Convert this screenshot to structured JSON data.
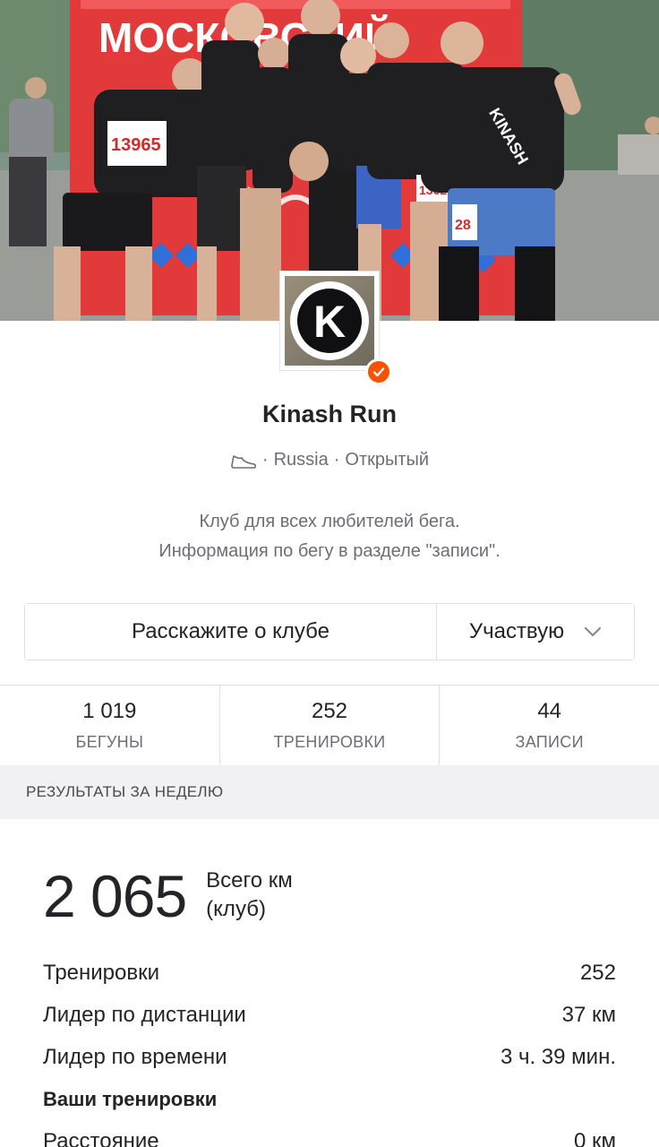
{
  "cover": {
    "banner_text": "МОСКОВСКИЙ",
    "bib_numbers": [
      "13965",
      "13629",
      "28"
    ],
    "shirt_text": "KINASH"
  },
  "club": {
    "name": "Kinash Run",
    "sport_icon": "running-shoe-icon",
    "location": "Russia",
    "privacy": "Открытый",
    "description_line1": "Клуб для всех любителей бега.",
    "description_line2": "Информация по бегу в разделе \"записи\".",
    "verified": true,
    "logo_letter": "K",
    "accent_color": "#fc5200"
  },
  "actions": {
    "about_label": "Расскажите о клубе",
    "join_label": "Участвую"
  },
  "stats": [
    {
      "value": "1 019",
      "label": "БЕГУНЫ"
    },
    {
      "value": "252",
      "label": "ТРЕНИРОВКИ"
    },
    {
      "value": "44",
      "label": "ЗАПИСИ"
    }
  ],
  "weekly": {
    "heading": "РЕЗУЛЬТАТЫ ЗА НЕДЕЛЮ",
    "total_value": "2 065",
    "total_label_line1": "Всего км",
    "total_label_line2": "(клуб)",
    "rows": [
      {
        "label": "Тренировки",
        "value": "252"
      },
      {
        "label": "Лидер по дистанции",
        "value": "37 км"
      },
      {
        "label": "Лидер по времени",
        "value": "3 ч. 39 мин."
      }
    ],
    "your_heading": "Ваши тренировки",
    "your_rows": [
      {
        "label": "Расстояние",
        "value": "0 км"
      }
    ]
  }
}
